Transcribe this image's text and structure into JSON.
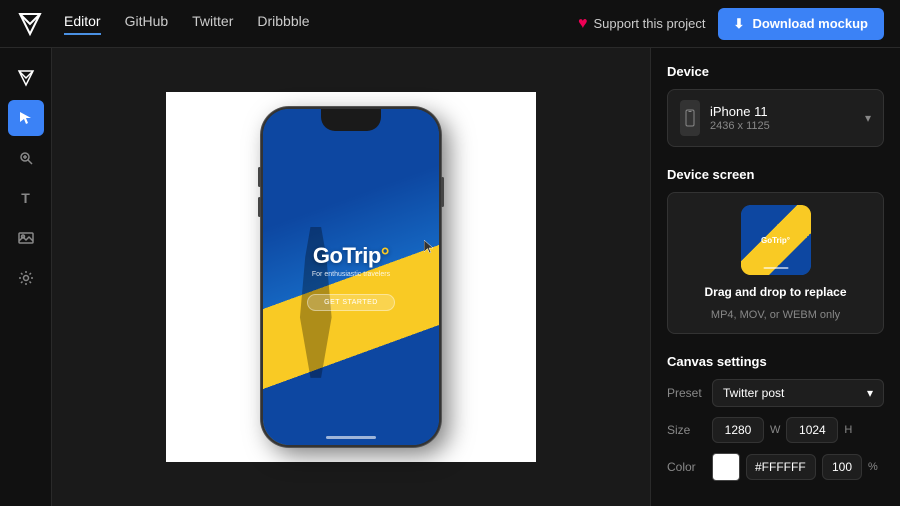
{
  "nav": {
    "links": [
      {
        "label": "Editor",
        "active": true
      },
      {
        "label": "GitHub",
        "active": false
      },
      {
        "label": "Twitter",
        "active": false
      },
      {
        "label": "Dribbble",
        "active": false
      }
    ],
    "support_label": "Support this project",
    "download_label": "Download mockup"
  },
  "sidebar": {
    "tools": [
      {
        "name": "cursor-tool",
        "icon": "✦",
        "active": false
      },
      {
        "name": "select-tool",
        "icon": "↖",
        "active": true
      },
      {
        "name": "zoom-tool",
        "icon": "⊕",
        "active": false
      },
      {
        "name": "text-tool",
        "icon": "T",
        "active": false
      },
      {
        "name": "image-tool",
        "icon": "▣",
        "active": false
      },
      {
        "name": "settings-tool",
        "icon": "⚙",
        "active": false
      }
    ]
  },
  "right_panel": {
    "device_section_title": "Device",
    "device": {
      "name": "iPhone 11",
      "resolution": "2436 x 1125"
    },
    "screen_section_title": "Device screen",
    "screen_drag_text": "Drag and drop to replace",
    "screen_format_text": "MP4, MOV, or WEBM only",
    "canvas_section_title": "Canvas settings",
    "preset_label": "Preset",
    "preset_value": "Twitter post",
    "size_label": "Size",
    "size_w": "1280",
    "size_h": "1024",
    "color_label": "Color",
    "color_hex": "#FFFFFF",
    "color_opacity": "100"
  },
  "app": {
    "logo": "GoTrip",
    "logo_dot": "°",
    "tagline": "For enthusiastic travelers",
    "button_text": "GET STARTED"
  }
}
